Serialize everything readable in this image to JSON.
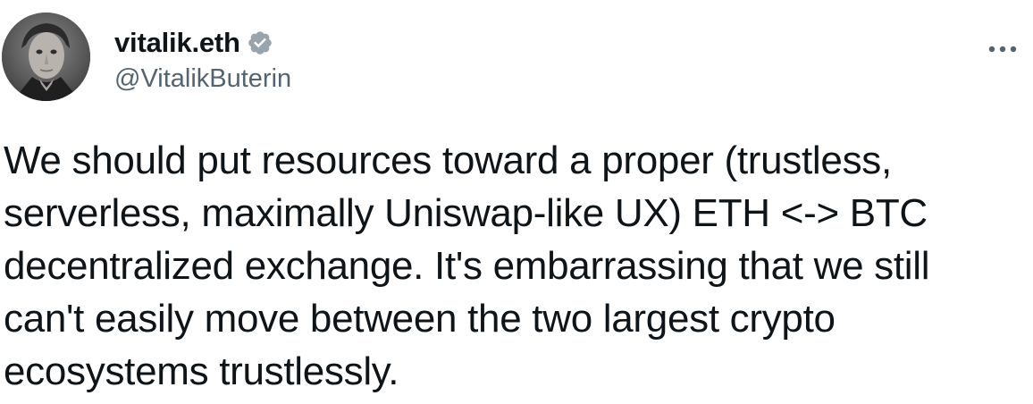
{
  "tweet": {
    "author": {
      "display_name": "vitalik.eth",
      "handle": "@VitalikButerin",
      "verified": true,
      "avatar_icon": "profile-photo",
      "verified_icon": "verified-badge-icon"
    },
    "more_icon": "more-options-icon",
    "text": "We should put resources toward a proper (trustless,\nserverless, maximally Uniswap-like UX) ETH <-> BTC\ndecentralized exchange. It's embarrassing that we still\ncan't easily move between the two largest crypto\necosystems trustlessly."
  },
  "colors": {
    "text": "#0f1419",
    "secondary_text": "#536471",
    "verified_badge": "#9aa4ad"
  }
}
